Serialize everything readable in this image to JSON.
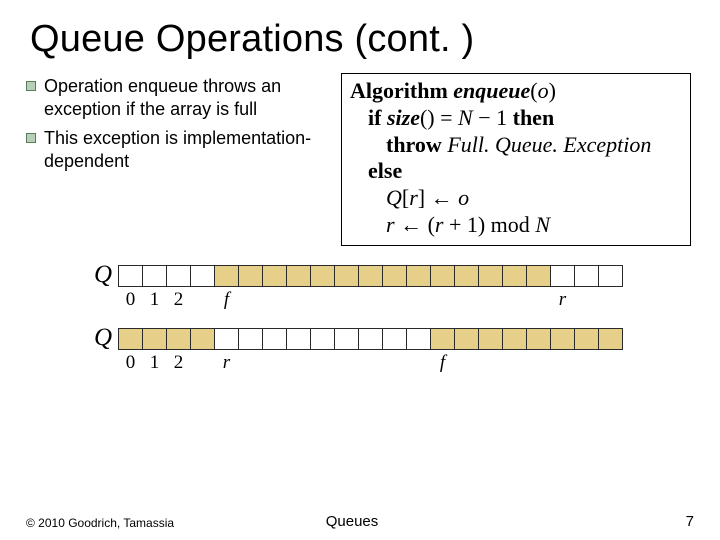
{
  "title": "Queue Operations (cont. )",
  "bullets": [
    "Operation enqueue throws an exception if the array is full",
    "This exception is implementation-dependent"
  ],
  "algo": {
    "l1_a": "Algorithm",
    "l1_b": "enqueue",
    "l1_c": "(",
    "l1_d": "o",
    "l1_e": ")",
    "l2_a": "if ",
    "l2_b": "size",
    "l2_c": "() = ",
    "l2_d": "N",
    "l2_e": " − 1 ",
    "l2_f": "then",
    "l3_a": "throw ",
    "l3_b": "Full. Queue. Exception",
    "l4": "else",
    "l5_a": "Q",
    "l5_b": "[",
    "l5_c": "r",
    "l5_d": "] ",
    "l5_e": "←",
    "l5_f": " o",
    "l6_a": "r",
    "l6_b": " ",
    "l6_c": "←",
    "l6_d": " (",
    "l6_e": "r",
    "l6_f": " + 1) mod ",
    "l6_g": "N"
  },
  "diagram": {
    "Q": "Q",
    "labels": {
      "i0": "0",
      "i1": "1",
      "i2": "2",
      "f": "f",
      "r": "r"
    }
  },
  "footer": {
    "copyright": "© 2010 Goodrich, Tamassia",
    "center": "Queues",
    "page": "7"
  }
}
